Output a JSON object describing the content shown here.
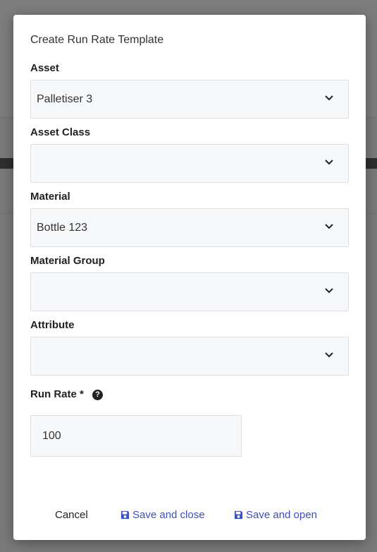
{
  "dialog": {
    "title": "Create Run Rate Template",
    "fields": [
      {
        "label": "Asset",
        "value": "Palletiser 3"
      },
      {
        "label": "Asset Class",
        "value": ""
      },
      {
        "label": "Material",
        "value": "Bottle 123"
      },
      {
        "label": "Material Group",
        "value": ""
      },
      {
        "label": "Attribute",
        "value": ""
      }
    ],
    "run_rate": {
      "label": "Run Rate *",
      "help_icon": "question-circle-icon",
      "value": "100"
    },
    "buttons": {
      "cancel": "Cancel",
      "save_close": "Save and close",
      "save_open": "Save and open"
    },
    "colors": {
      "primary": "#3a4fc7",
      "field_bg": "#f7f8fa",
      "overlay": "#7a7a7a"
    }
  }
}
